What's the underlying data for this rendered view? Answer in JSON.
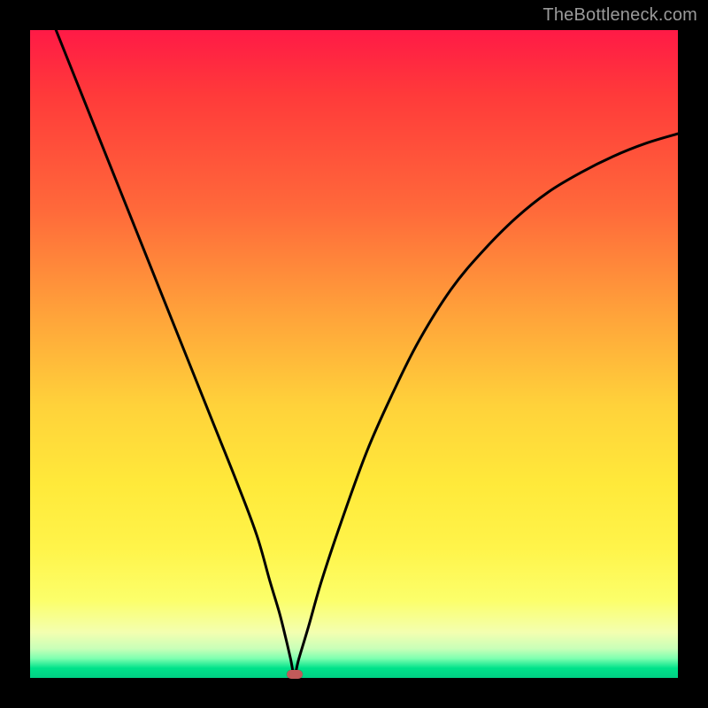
{
  "watermark": "TheBottleneck.com",
  "colors": {
    "curve": "#000000",
    "marker": "#c25a5a",
    "frame": "#000000"
  },
  "chart_data": {
    "type": "line",
    "title": "",
    "xlabel": "",
    "ylabel": "",
    "xlim": [
      0,
      100
    ],
    "ylim": [
      0,
      100
    ],
    "grid": false,
    "legend": false,
    "annotations": [
      {
        "kind": "marker",
        "x": 40.8,
        "y": 0.5,
        "shape": "rounded-rect",
        "color": "#c25a5a"
      }
    ],
    "series": [
      {
        "name": "bottleneck-curve",
        "color": "#000000",
        "x": [
          4,
          8,
          12,
          16,
          20,
          24,
          28,
          32,
          35,
          37,
          38.5,
          39.5,
          40.2,
          40.8,
          41.5,
          43,
          45,
          48,
          52,
          56,
          60,
          65,
          70,
          75,
          80,
          85,
          90,
          95,
          100
        ],
        "y": [
          100,
          90,
          80,
          70,
          60,
          50,
          40,
          30,
          22,
          15,
          10,
          6,
          3,
          0.5,
          3,
          8,
          15,
          24,
          35,
          44,
          52,
          60,
          66,
          71,
          75,
          78,
          80.5,
          82.5,
          84
        ]
      }
    ]
  }
}
